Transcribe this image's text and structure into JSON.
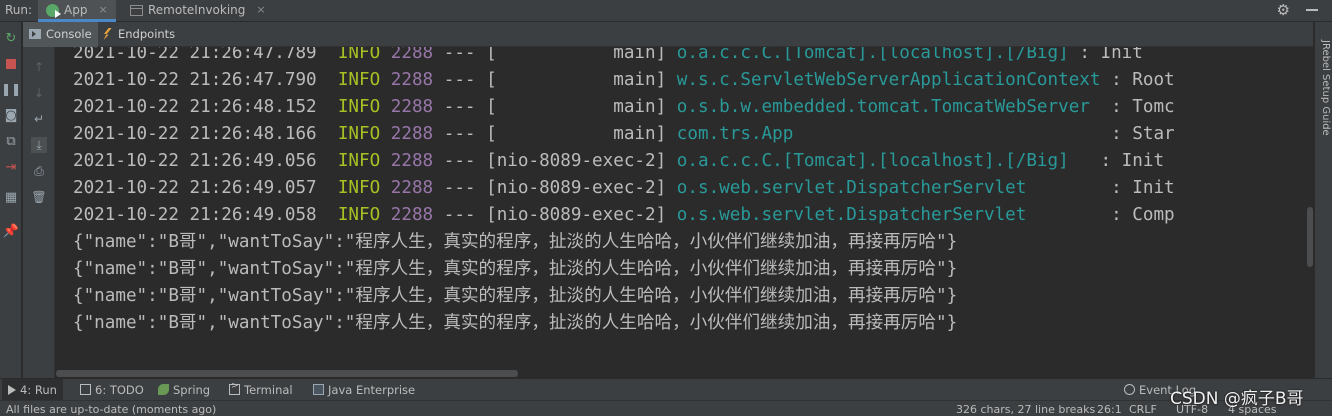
{
  "run_bar": {
    "label": "Run:",
    "tabs": [
      {
        "label": "App",
        "active": true
      },
      {
        "label": "RemoteInvoking",
        "active": false
      }
    ],
    "close_glyph": "×"
  },
  "sub_tabs": [
    {
      "label": "Console",
      "active": true
    },
    {
      "label": "Endpoints",
      "active": false
    }
  ],
  "log_lines": [
    {
      "date": "2021-10-22 21:26:47.789",
      "level": "INFO",
      "pid": "2288",
      "sep": "---",
      "thread": "[           main]",
      "logger": "o.a.c.c.C.[Tomcat].[localhost].[/Big]",
      "msg": ": Init"
    },
    {
      "date": "2021-10-22 21:26:47.790",
      "level": "INFO",
      "pid": "2288",
      "sep": "---",
      "thread": "[           main]",
      "logger": "w.s.c.ServletWebServerApplicationContext",
      "msg": ": Root"
    },
    {
      "date": "2021-10-22 21:26:48.152",
      "level": "INFO",
      "pid": "2288",
      "sep": "---",
      "thread": "[           main]",
      "logger": "o.s.b.w.embedded.tomcat.TomcatWebServer ",
      "msg": ": Tomc"
    },
    {
      "date": "2021-10-22 21:26:48.166",
      "level": "INFO",
      "pid": "2288",
      "sep": "---",
      "thread": "[           main]",
      "logger": "com.trs.App                             ",
      "msg": ": Star"
    },
    {
      "date": "2021-10-22 21:26:49.056",
      "level": "INFO",
      "pid": "2288",
      "sep": "---",
      "thread": "[nio-8089-exec-2]",
      "logger": "o.a.c.c.C.[Tomcat].[localhost].[/Big]  ",
      "msg": ": Init"
    },
    {
      "date": "2021-10-22 21:26:49.057",
      "level": "INFO",
      "pid": "2288",
      "sep": "---",
      "thread": "[nio-8089-exec-2]",
      "logger": "o.s.web.servlet.DispatcherServlet       ",
      "msg": ": Init"
    },
    {
      "date": "2021-10-22 21:26:49.058",
      "level": "INFO",
      "pid": "2288",
      "sep": "---",
      "thread": "[nio-8089-exec-2]",
      "logger": "o.s.web.servlet.DispatcherServlet       ",
      "msg": ": Comp"
    }
  ],
  "json_lines": [
    "{\"name\":\"B哥\",\"wantToSay\":\"程序人生，真实的程序，扯淡的人生哈哈，小伙伴们继续加油，再接再厉哈\"}",
    "{\"name\":\"B哥\",\"wantToSay\":\"程序人生，真实的程序，扯淡的人生哈哈，小伙伴们继续加油，再接再厉哈\"}",
    "{\"name\":\"B哥\",\"wantToSay\":\"程序人生，真实的程序，扯淡的人生哈哈，小伙伴们继续加油，再接再厉哈\"}",
    "{\"name\":\"B哥\",\"wantToSay\":\"程序人生，真实的程序，扯淡的人生哈哈，小伙伴们继续加油，再接再厉哈\"}"
  ],
  "right_tab": "JRebel Setup Guide",
  "bottom_tabs": [
    {
      "label": "4: Run",
      "active": true
    },
    {
      "label": "6: TODO",
      "active": false
    },
    {
      "label": "Spring",
      "active": false
    },
    {
      "label": "Terminal",
      "active": false
    },
    {
      "label": "Java Enterprise",
      "active": false
    }
  ],
  "event_log": "Event Log",
  "status": {
    "message": "All files are up-to-date (moments ago)",
    "chars": "326 chars, 27 line breaks",
    "position": "26:1",
    "line_sep": "CRLF",
    "encoding": "UTF-8",
    "indent": "4 spaces"
  },
  "watermark": "CSDN @疯子B哥",
  "colors": {
    "info": "#a8c023",
    "pid": "#9876aa",
    "logger": "#299999",
    "text": "#bbbbbb",
    "background": "#2b2b2b"
  }
}
